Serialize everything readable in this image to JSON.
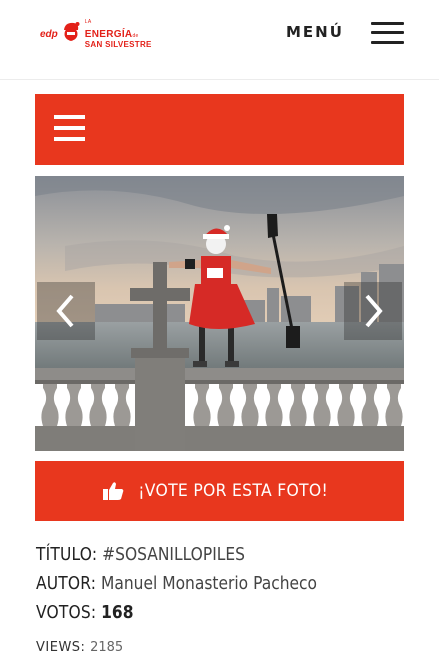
{
  "header": {
    "logo": {
      "edp": "edp",
      "small": "LA",
      "main": "ENERGÍA",
      "small2": "de",
      "sub": "SAN SILVESTRE"
    },
    "menu_label": "MENÚ",
    "icons": [
      "hamburger-menu-icon"
    ]
  },
  "nav_bar": {
    "icon": "hamburger-menu-icon",
    "color": "#e8371e"
  },
  "photo": {
    "icons": [
      "chevron-left-icon",
      "chevron-right-icon"
    ]
  },
  "vote": {
    "icon": "thumbs-up-icon",
    "label": "¡VOTE POR ESTA FOTO!",
    "color": "#e8371e"
  },
  "info": {
    "title_key": "TÍTULO:",
    "title_value": "#SOSANILLOPILES",
    "author_key": "AUTOR:",
    "author_value": "Manuel Monasterio Pacheco",
    "votes_key": "VOTOS:",
    "votes_value": "168",
    "views_key": "VIEWS:",
    "views_value": "2185"
  }
}
